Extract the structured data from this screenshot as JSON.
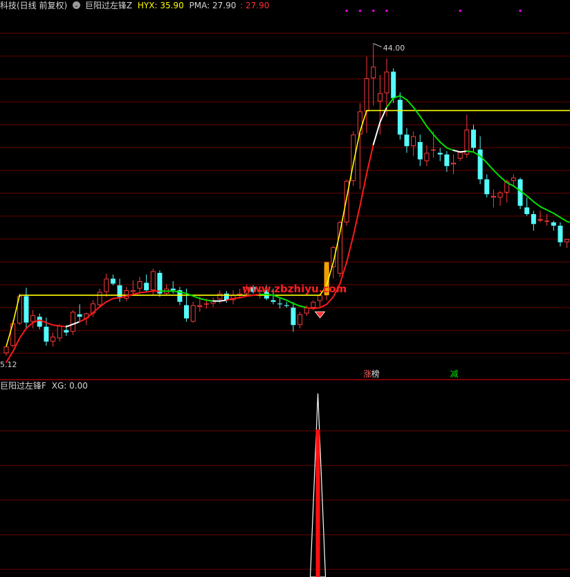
{
  "header": {
    "stock_title": "科技(日线 前复权)",
    "indicator_name": "巨阳过左锋Z",
    "hyx_label": "HYX: ",
    "hyx_value": "35.90",
    "pma_label": "PMA: ",
    "pma_value": "27.90",
    "extra_label": ": ",
    "extra_value": "27.90"
  },
  "sub_header": {
    "indicator_name": "巨阳过左锋F",
    "xg_label": "XG: ",
    "xg_value": "0.00"
  },
  "watermark": "www.zbzhiyu.com",
  "colors": {
    "background": "#000000",
    "grid": "#6a0000",
    "divider": "#c00000",
    "up": "#ff3b3b",
    "down": "#54fcfc",
    "ma_yellow": "#ffff00",
    "ma_red": "#ff1a1a",
    "ma_green": "#00e000",
    "ma_white": "#ffffff",
    "watermark": "#ff2020",
    "header_text": "#d6d6d6",
    "magenta_dots": "#ff00ff"
  },
  "chart_data": [
    {
      "type": "candlestick",
      "title": "",
      "ylim": [
        4.5,
        48
      ],
      "annotations": [
        {
          "text": "44.00",
          "kind": "high",
          "bar": 55
        },
        {
          "text": "5.12",
          "kind": "low",
          "bar": 0
        }
      ],
      "bottom_tags": [
        {
          "text": "涨",
          "bar": 54,
          "color": "#ff6060"
        },
        {
          "text": "榜",
          "bar": 55,
          "color": "#e0e0e0"
        },
        {
          "text": "减",
          "bar": 67,
          "color": "#00e000"
        }
      ],
      "signal_marker": {
        "kind": "diamond",
        "bar": 47,
        "color": "#ff3030"
      },
      "magenta_dots_bars": [
        51,
        53,
        55,
        57,
        68,
        77
      ],
      "candles": [
        [
          6.6,
          7.6,
          6.3,
          7.4
        ],
        [
          7.5,
          10.6,
          7.3,
          10.2
        ],
        [
          10.2,
          13.8,
          10.0,
          13.5
        ],
        [
          13.5,
          14.5,
          9.6,
          10.3
        ],
        [
          10.4,
          11.8,
          9.6,
          11.2
        ],
        [
          11.0,
          11.4,
          9.5,
          9.8
        ],
        [
          9.8,
          10.9,
          7.5,
          8.0
        ],
        [
          8.0,
          9.1,
          7.4,
          8.6
        ],
        [
          8.4,
          10.1,
          8.0,
          9.9
        ],
        [
          9.4,
          10.0,
          8.7,
          9.1
        ],
        [
          9.2,
          11.8,
          8.8,
          11.6
        ],
        [
          11.3,
          12.5,
          10.4,
          11.0
        ],
        [
          10.8,
          11.5,
          10.0,
          11.4
        ],
        [
          11.4,
          13.0,
          11.0,
          12.6
        ],
        [
          12.4,
          14.4,
          12.1,
          14.0
        ],
        [
          14.0,
          16.2,
          13.4,
          15.6
        ],
        [
          15.6,
          16.1,
          14.8,
          15.0
        ],
        [
          14.8,
          15.6,
          12.8,
          13.4
        ],
        [
          13.2,
          14.6,
          12.9,
          14.2
        ],
        [
          14.0,
          15.4,
          13.6,
          14.2
        ],
        [
          14.4,
          15.8,
          14.0,
          15.3
        ],
        [
          15.1,
          16.1,
          14.0,
          14.2
        ],
        [
          14.2,
          16.8,
          13.6,
          16.5
        ],
        [
          16.3,
          16.6,
          13.4,
          13.8
        ],
        [
          13.8,
          14.9,
          13.6,
          14.4
        ],
        [
          14.4,
          15.3,
          13.8,
          14.2
        ],
        [
          14.2,
          14.6,
          12.4,
          12.8
        ],
        [
          12.4,
          14.4,
          10.4,
          10.8
        ],
        [
          10.4,
          12.8,
          10.3,
          12.4
        ],
        [
          12.2,
          13.5,
          11.6,
          12.4
        ],
        [
          12.5,
          13.2,
          12.0,
          12.6
        ],
        [
          12.6,
          13.3,
          12.2,
          13.0
        ],
        [
          13.1,
          14.2,
          12.6,
          13.8
        ],
        [
          13.8,
          14.1,
          12.7,
          13.0
        ],
        [
          13.0,
          14.2,
          12.5,
          13.6
        ],
        [
          13.6,
          14.4,
          13.2,
          13.8
        ],
        [
          13.8,
          14.9,
          13.4,
          14.6
        ],
        [
          14.6,
          14.8,
          13.8,
          14.0
        ],
        [
          14.0,
          14.6,
          13.2,
          14.2
        ],
        [
          14.2,
          14.8,
          13.0,
          13.2
        ],
        [
          13.0,
          14.4,
          12.5,
          12.8
        ],
        [
          12.6,
          13.2,
          12.0,
          12.5
        ],
        [
          12.4,
          12.8,
          12.1,
          12.3
        ],
        [
          12.1,
          12.8,
          9.2,
          10.0
        ],
        [
          10.0,
          11.6,
          9.6,
          11.3
        ],
        [
          11.4,
          12.4,
          11.1,
          12.1
        ],
        [
          12.1,
          13.0,
          11.8,
          12.8
        ],
        [
          12.9,
          13.8,
          12.2,
          13.6
        ],
        [
          13.6,
          17.6,
          13.0,
          17.0
        ],
        [
          17.0,
          19.6,
          15.6,
          19.4
        ],
        [
          16.2,
          22.6,
          15.8,
          22.4
        ],
        [
          22.4,
          27.6,
          22.0,
          27.4
        ],
        [
          27.4,
          33.4,
          26.8,
          33.0
        ],
        [
          33.0,
          36.8,
          26.4,
          35.8
        ],
        [
          35.8,
          42.4,
          33.2,
          39.8
        ],
        [
          39.8,
          44.0,
          36.5,
          41.2
        ],
        [
          37.0,
          40.2,
          33.0,
          38.0
        ],
        [
          38.0,
          42.2,
          35.2,
          40.6
        ],
        [
          40.6,
          41.0,
          36.8,
          37.4
        ],
        [
          37.2,
          38.1,
          32.4,
          33.0
        ],
        [
          33.0,
          33.8,
          30.8,
          31.6
        ],
        [
          31.6,
          33.4,
          30.4,
          32.8
        ],
        [
          32.1,
          33.0,
          29.2,
          30.0
        ],
        [
          29.8,
          31.7,
          29.2,
          30.8
        ],
        [
          31.2,
          33.4,
          30.2,
          31.2
        ],
        [
          30.8,
          31.4,
          29.8,
          30.6
        ],
        [
          30.6,
          31.0,
          28.5,
          29.2
        ],
        [
          29.4,
          30.6,
          28.2,
          29.6
        ],
        [
          30.1,
          31.0,
          29.8,
          30.9
        ],
        [
          30.6,
          35.4,
          30.2,
          33.6
        ],
        [
          33.6,
          34.2,
          31.0,
          31.4
        ],
        [
          31.2,
          32.8,
          27.0,
          27.6
        ],
        [
          27.6,
          28.2,
          25.4,
          25.8
        ],
        [
          25.4,
          26.4,
          24.2,
          25.6
        ],
        [
          25.4,
          26.2,
          24.4,
          26.0
        ],
        [
          26.0,
          27.6,
          24.8,
          27.4
        ],
        [
          27.4,
          28.2,
          26.8,
          27.8
        ],
        [
          27.6,
          27.8,
          24.0,
          24.4
        ],
        [
          24.2,
          25.4,
          23.2,
          23.4
        ],
        [
          23.4,
          23.8,
          21.4,
          22.2
        ],
        [
          22.6,
          23.8,
          22.4,
          22.8
        ],
        [
          22.6,
          23.4,
          22.0,
          22.6
        ],
        [
          22.4,
          22.6,
          21.4,
          22.0
        ],
        [
          22.0,
          22.4,
          19.5,
          20.0
        ],
        [
          20.0,
          20.4,
          19.3,
          20.4
        ]
      ],
      "ma_fast": [
        5.5,
        6.8,
        8.4,
        9.6,
        10.3,
        10.6,
        10.3,
        10.0,
        9.9,
        9.8,
        10.1,
        10.4,
        10.8,
        11.5,
        12.2,
        12.8,
        13.2,
        13.3,
        13.5,
        13.7,
        13.9,
        14.0,
        14.1,
        14.1,
        14.1,
        14.1,
        14.0,
        13.8,
        13.5,
        13.2,
        13.0,
        12.9,
        12.9,
        13.0,
        13.2,
        13.3,
        13.5,
        13.6,
        13.7,
        13.7,
        13.6,
        13.3,
        13.0,
        12.6,
        12.3,
        12.1,
        12.0,
        12.1,
        12.5,
        13.4,
        15.0,
        17.6,
        20.8,
        24.4,
        28.3,
        31.8,
        34.5,
        36.3,
        37.4,
        37.7,
        37.2,
        36.3,
        35.2,
        34.0,
        33.0,
        32.1,
        31.4,
        31.1,
        30.9,
        31.0,
        30.9,
        30.4,
        29.6,
        28.7,
        27.9,
        27.2,
        26.8,
        26.2,
        25.6,
        24.9,
        24.3,
        23.9,
        23.5,
        23.0,
        22.5
      ],
      "ma_fast_colors": [
        "r",
        "r",
        "r",
        "r",
        "r",
        "r",
        "r",
        "r",
        "r",
        "r",
        "w",
        "w",
        "r",
        "r",
        "r",
        "r",
        "r",
        "r",
        "r",
        "r",
        "r",
        "r",
        "r",
        "r",
        "g",
        "g",
        "g",
        "g",
        "g",
        "g",
        "g",
        "g",
        "w",
        "w",
        "r",
        "r",
        "r",
        "r",
        "r",
        "g",
        "g",
        "g",
        "g",
        "g",
        "g",
        "g",
        "r",
        "r",
        "r",
        "r",
        "r",
        "r",
        "r",
        "r",
        "r",
        "r",
        "w",
        "w",
        "g",
        "g",
        "g",
        "g",
        "g",
        "g",
        "g",
        "g",
        "g",
        "g",
        "w",
        "w",
        "g",
        "g",
        "g",
        "g",
        "g",
        "g",
        "g",
        "g",
        "g",
        "g",
        "g",
        "g",
        "g",
        "g",
        "g"
      ],
      "ma_slow": [
        7.4,
        10.2,
        13.6,
        13.6,
        13.6,
        13.6,
        13.6,
        13.6,
        13.6,
        13.6,
        13.6,
        13.6,
        13.6,
        13.6,
        13.6,
        13.6,
        13.6,
        13.6,
        13.6,
        13.6,
        13.6,
        13.6,
        13.6,
        13.6,
        13.6,
        13.6,
        13.6,
        13.6,
        13.6,
        13.6,
        13.6,
        13.6,
        13.6,
        13.6,
        13.6,
        13.6,
        13.6,
        13.6,
        13.6,
        13.6,
        13.6,
        13.6,
        13.6,
        13.6,
        13.6,
        13.6,
        13.6,
        13.6,
        14.8,
        17.6,
        21.2,
        25.4,
        29.5,
        33.4,
        35.9,
        35.9,
        35.9,
        35.9,
        35.9,
        35.9,
        35.9,
        35.9,
        35.9,
        35.9,
        35.9,
        35.9,
        35.9,
        35.9,
        35.9,
        35.9,
        35.9,
        35.9,
        35.9,
        35.9,
        35.9,
        35.9,
        35.9,
        35.9,
        35.9,
        35.9,
        35.9,
        35.9,
        35.9,
        35.9,
        35.9
      ]
    },
    {
      "type": "line",
      "title": "",
      "ylim": [
        0,
        1
      ],
      "spike": {
        "bar": 47,
        "value": 1.0,
        "fill_color": "#ff1010",
        "outline_color": "#ffffff"
      }
    }
  ]
}
